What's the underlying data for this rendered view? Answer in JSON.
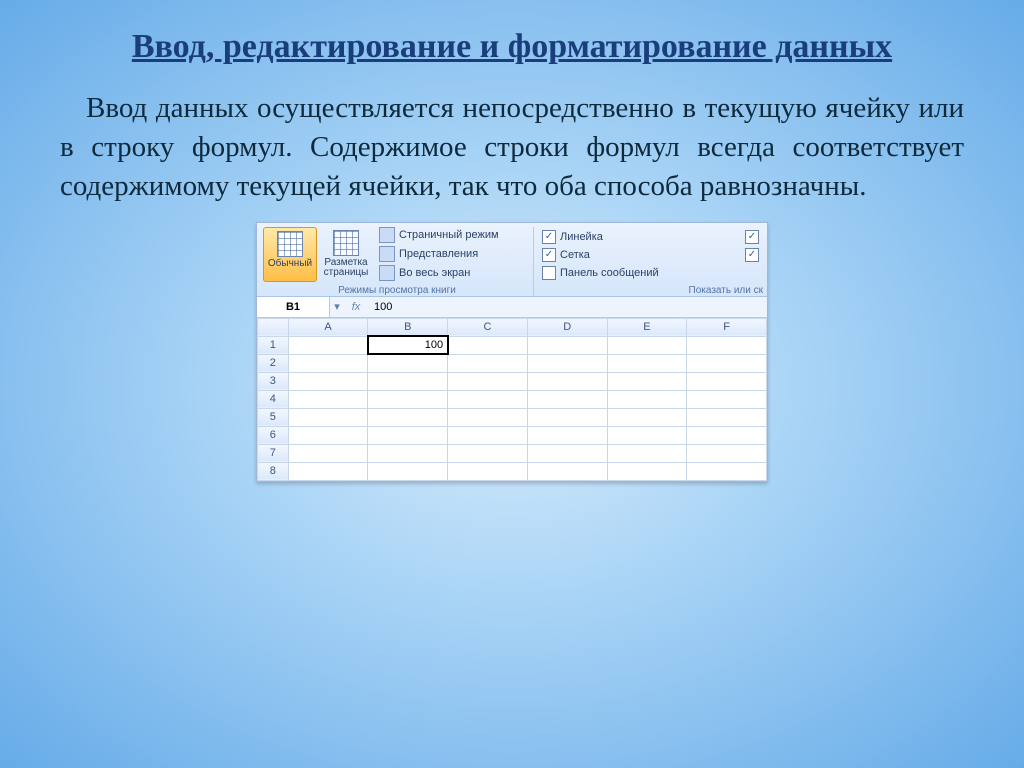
{
  "heading": "Ввод, редактирование и форматирование данных",
  "paragraph": "Ввод данных осуществляется непосредственно в текущую ячейку или в строку формул. Содержимое строки формул всегда соответствует содержимому текущей ячейки, так что оба способа равнозначны.",
  "ribbon": {
    "view_normal": "Обычный",
    "view_layout": "Разметка страницы",
    "small1": "Страничный режим",
    "small2": "Представления",
    "small3": "Во весь экран",
    "group1_label": "Режимы просмотра книги",
    "chk_ruler": "Линейка",
    "chk_grid": "Сетка",
    "chk_msgpanel": "Панель сообщений",
    "group2_label": "Показать или ск"
  },
  "formula_bar": {
    "name_box": "B1",
    "fx": "fx",
    "value": "100"
  },
  "grid": {
    "cols": [
      "A",
      "B",
      "C",
      "D",
      "E",
      "F"
    ],
    "rows": [
      "1",
      "2",
      "3",
      "4",
      "5",
      "6",
      "7",
      "8"
    ],
    "active_col": "B",
    "active_row": "1",
    "cells": {
      "B1": "100"
    }
  }
}
